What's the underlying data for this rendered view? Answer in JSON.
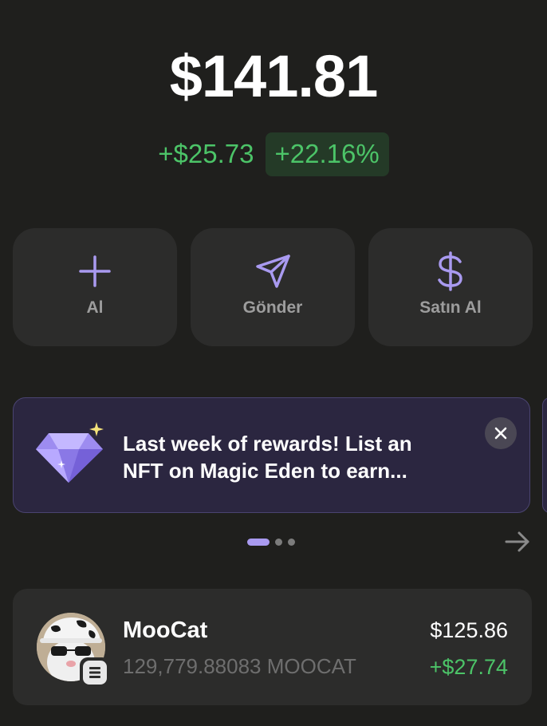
{
  "wallet": {
    "balance": "$141.81",
    "change_amount": "+$25.73",
    "change_percent": "+22.16%"
  },
  "actions": [
    {
      "label": "Al",
      "icon": "plus-icon"
    },
    {
      "label": "Gönder",
      "icon": "send-icon"
    },
    {
      "label": "Satın Al",
      "icon": "dollar-icon"
    }
  ],
  "promo": {
    "text": "Last week of rewards! List an NFT on Magic Eden to earn...",
    "icon": "diamond-icon",
    "carousel_page": 1,
    "carousel_total": 3
  },
  "tokens": [
    {
      "name": "MooCat",
      "amount": "129,779.88083 MOOCAT",
      "value": "$125.86",
      "change": "+$27.74"
    }
  ],
  "colors": {
    "background": "#1f1f1d",
    "accent": "#a99af0",
    "positive": "#4cc468",
    "card": "#2c2c2b"
  }
}
